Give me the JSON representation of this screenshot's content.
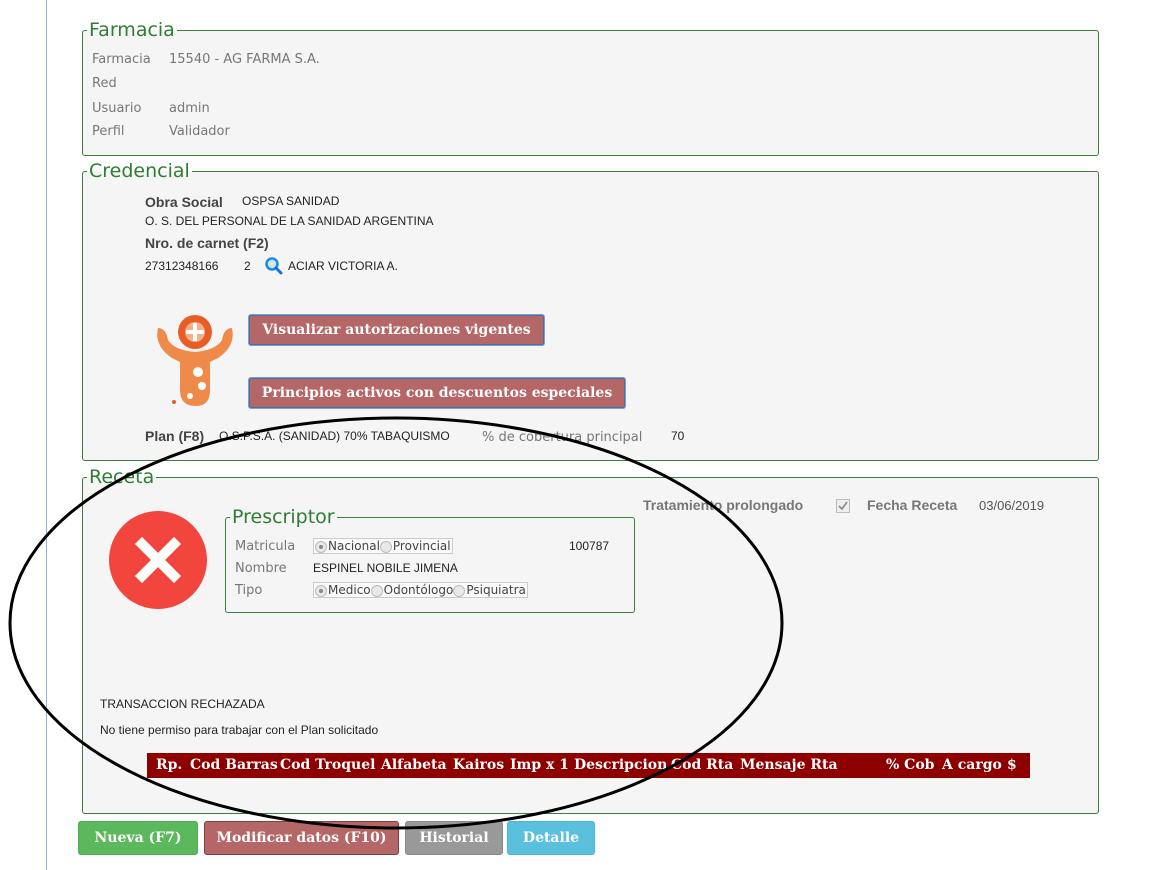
{
  "farmacia": {
    "legend": "Farmacia",
    "farmacia_label": "Farmacia",
    "farmacia_value": "15540 - AG FARMA S.A.",
    "red_label": "Red",
    "usuario_label": "Usuario",
    "usuario_value": "admin",
    "perfil_label": "Perfil",
    "perfil_value": "Validador"
  },
  "credencial": {
    "legend": "Credencial",
    "obra_social_label": "Obra Social",
    "obra_social_value": "OSPSA SANIDAD",
    "obra_social_full": "O. S. DEL PERSONAL DE LA SANIDAD ARGENTINA",
    "carnet_label": "Nro. de carnet (F2)",
    "carnet_number": "27312348166",
    "carnet_suffix": "2",
    "afiliado_name": "ACIAR VICTORIA A.",
    "btn_autorizaciones": "Visualizar autorizaciones vigentes",
    "btn_principios": "Principios activos con descuentos especiales",
    "plan_label": "Plan (F8)",
    "plan_value": "O.S.P.S.A. (SANIDAD) 70% TABAQUISMO",
    "cobertura_label": "% de cobertura principal",
    "cobertura_value": "70"
  },
  "receta": {
    "legend": "Receta",
    "tratamiento_label": "Tratamiento prolongado",
    "fecha_label": "Fecha Receta",
    "fecha_value": "03/06/2019",
    "prescriptor": {
      "legend": "Prescriptor",
      "matricula_label": "Matricula",
      "matricula_options": [
        "Nacional",
        "Provincial"
      ],
      "matricula_selected": "Nacional",
      "matricula_value": "100787",
      "nombre_label": "Nombre",
      "nombre_value": "ESPINEL NOBILE JIMENA",
      "tipo_label": "Tipo",
      "tipo_options": [
        "Medico",
        "Odontólogo",
        "Psiquiatra"
      ],
      "tipo_selected": "Medico"
    },
    "status_title": "TRANSACCION RECHAZADA",
    "status_message": "No tiene permiso para trabajar con el Plan solicitado",
    "columns": [
      "Rp.",
      "Cod Barras",
      "Cod Troquel",
      "Alfabeta",
      "Kairos",
      "Imp x 1",
      "Descripcion",
      "Cod Rta",
      "Mensaje Rta",
      "% Cob",
      "A cargo",
      "$"
    ]
  },
  "buttons": {
    "nueva": "Nueva (F7)",
    "modificar": "Modificar datos (F10)",
    "historial": "Historial",
    "detalle": "Detalle"
  },
  "colors": {
    "legend_green": "#2e7d32",
    "button_red": "#b56666",
    "table_header": "#8e0000",
    "reject_red": "#f2453d",
    "nueva_green": "#5cb85c",
    "detalle_blue": "#5bc0de",
    "historial_gray": "#999999"
  },
  "icons": [
    "search-icon",
    "pharmacy-mascot-icon",
    "reject-x-icon",
    "checkbox-checked-icon"
  ]
}
